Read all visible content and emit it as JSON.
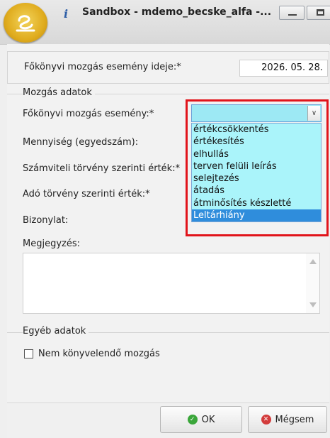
{
  "window": {
    "title": "Sandbox - mdemo_becske_alfa -..."
  },
  "header_row": {
    "event_time_label": "Főkönyvi mozgás esemény ideje:*",
    "event_time_value": "2026. 05. 28."
  },
  "movement_group": {
    "title": "Mozgás adatok",
    "event_label": "Főkönyvi mozgás esemény:*",
    "quantity_label": "Mennyiség (egyedszám):",
    "accounting_value_label": "Számviteli törvény szerinti érték:*",
    "tax_value_label": "Adó törvény szerinti érték:*",
    "voucher_label": "Bizonylat:",
    "note_label": "Megjegyzés:",
    "event_combo_value": "",
    "dropdown_options": [
      "értékcsökkentés",
      "értékesítés",
      "elhullás",
      "terven felüli leírás",
      "selejtezés",
      "átadás",
      "átminősítés készletté",
      "Leltárhiány"
    ],
    "dropdown_selected": "Leltárhiány"
  },
  "other_group": {
    "title": "Egyéb adatok",
    "non_posting_label": "Nem könyvelendő mozgás"
  },
  "buttons": {
    "ok_label": "OK",
    "cancel_label": "Mégsem"
  },
  "colors": {
    "highlight": "#e1141b",
    "dropdown_bg": "#aaf4fa",
    "selected_item": "#2f8ddc",
    "ok_icon": "#3aa63a",
    "cancel_icon": "#d33c3c"
  }
}
